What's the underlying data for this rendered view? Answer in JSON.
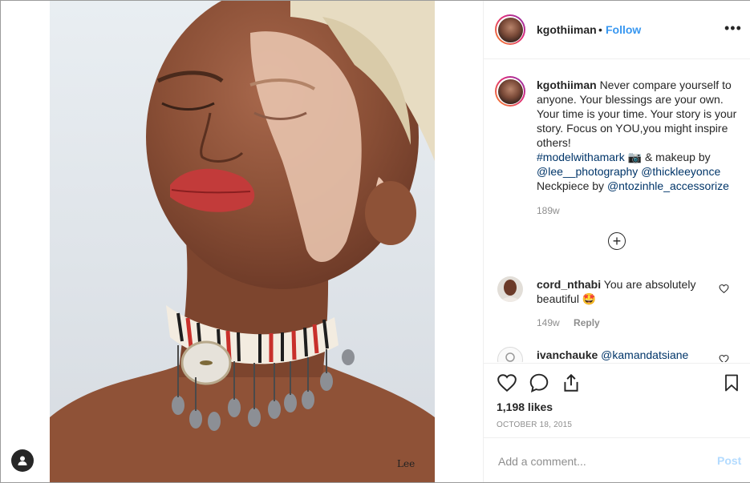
{
  "post": {
    "image_alt": "Portrait of a woman with a beaded choker necklace",
    "watermark": "Lee",
    "author": {
      "username": "kgothiiman",
      "separator": "•",
      "follow_label": "Follow",
      "more_icon": "more-horizontal-icon"
    },
    "caption": {
      "username": "kgothiiman",
      "text_1": "Never compare yourself to anyone. Your blessings are your own. Your time is your time. Your story is your story. Focus on YOU,you might inspire others!",
      "hashtag": "#modelwithamark",
      "camera_emoji": "📷",
      "text_2": "& makeup by",
      "mention_1": "@lee__photography",
      "mention_2": "@thickleeyonce",
      "text_3": "Neckpiece by",
      "mention_3": "@ntozinhle_accessorize",
      "time": "189w"
    },
    "load_more_icon": "plus-circle-icon",
    "load_more_symbol": "+",
    "comments": [
      {
        "username": "cord_nthabi",
        "text": "You are absolutely beautiful",
        "emoji": "🤩",
        "time": "149w",
        "reply_label": "Reply"
      },
      {
        "username": "ivanchauke",
        "mention": "@kamandatsiane"
      }
    ],
    "likes": "1,198 likes",
    "date": "OCTOBER 18, 2015",
    "add_comment_placeholder": "Add a comment...",
    "post_label": "Post"
  },
  "colors": {
    "link_blue": "#3897f0",
    "mention_blue": "#003569",
    "muted_gray": "#8e8e8e",
    "post_disabled": "#b3dbff",
    "text": "#262626"
  }
}
